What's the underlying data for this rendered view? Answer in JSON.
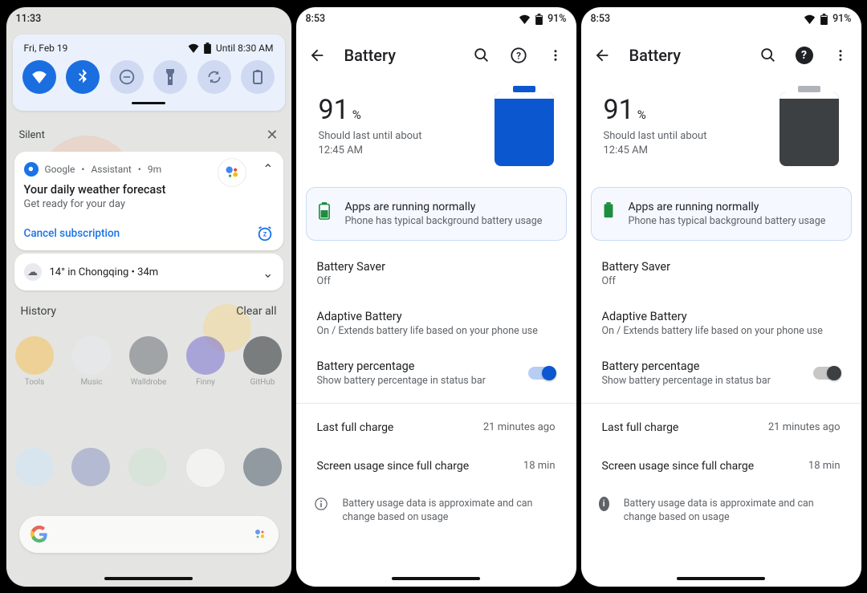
{
  "phoneA": {
    "status": {
      "time": "11:33"
    },
    "qs": {
      "date": "Fri, Feb 19",
      "until": "Until 8:30 AM",
      "tiles": [
        "wifi",
        "bluetooth",
        "dnd",
        "flashlight",
        "rotate",
        "battery"
      ]
    },
    "silent": {
      "label": "Silent"
    },
    "notif1": {
      "app": "Google",
      "sep": " • ",
      "sub": "Assistant",
      "age": "9m",
      "title": "Your daily weather forecast",
      "body": "Get ready for your day",
      "action": "Cancel subscription"
    },
    "notif2": {
      "text": "14° in Chongqing • 34m"
    },
    "history": {
      "label": "History",
      "clear": "Clear all"
    },
    "home": {
      "row1": [
        "Tools",
        "Music",
        "Walldrobe",
        "Finny",
        "GitHub"
      ]
    }
  },
  "phoneB": {
    "status": {
      "time": "8:53",
      "pct": "91%"
    },
    "title": "Battery",
    "pct": "91",
    "pct_unit": "%",
    "sub1": "Should last until about",
    "sub2": "12:45 AM",
    "card": {
      "t": "Apps are running normally",
      "s": "Phone has typical background battery usage"
    },
    "rows": {
      "saver": {
        "t": "Battery Saver",
        "s": "Off"
      },
      "adaptive": {
        "t": "Adaptive Battery",
        "s": "On / Extends battery life based on your phone use"
      },
      "pct": {
        "t": "Battery percentage",
        "s": "Show battery percentage in status bar"
      }
    },
    "kv1": {
      "k": "Last full charge",
      "v": "21 minutes ago"
    },
    "kv2": {
      "k": "Screen usage since full charge",
      "v": "18 min"
    },
    "foot": "Battery usage data is approximate and can change based on usage"
  },
  "phoneC": {
    "status": {
      "time": "8:53",
      "pct": "91%"
    },
    "title": "Battery",
    "pct": "91",
    "pct_unit": "%",
    "sub1": "Should last until about",
    "sub2": "12:45 AM",
    "card": {
      "t": "Apps are running normally",
      "s": "Phone has typical background battery usage"
    },
    "rows": {
      "saver": {
        "t": "Battery Saver",
        "s": "Off"
      },
      "adaptive": {
        "t": "Adaptive Battery",
        "s": "On / Extends battery life based on your phone use"
      },
      "pct": {
        "t": "Battery percentage",
        "s": "Show battery percentage in status bar"
      }
    },
    "kv1": {
      "k": "Last full charge",
      "v": "21 minutes ago"
    },
    "kv2": {
      "k": "Screen usage since full charge",
      "v": "18 min"
    },
    "foot": "Battery usage data is approximate and can change based on usage"
  }
}
